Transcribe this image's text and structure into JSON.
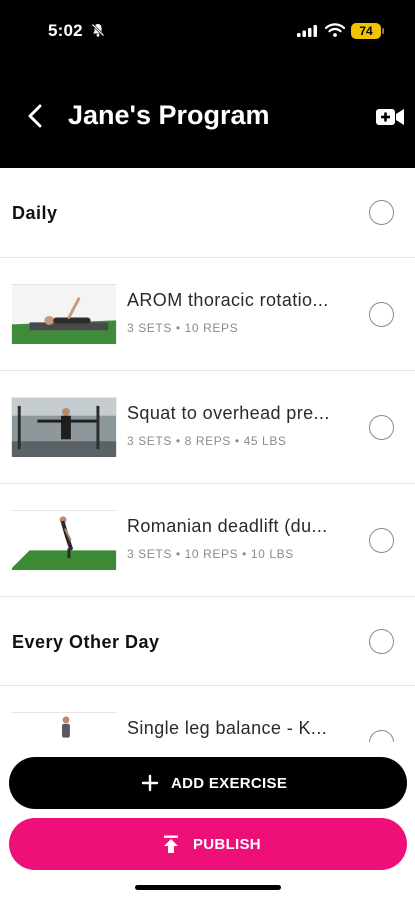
{
  "status_bar": {
    "time": "5:02",
    "battery": "74"
  },
  "header": {
    "title": "Jane's Program"
  },
  "sections": [
    {
      "label": "Daily",
      "exercises": [
        {
          "name": "AROM thoracic rotatio...",
          "meta": "3 SETS • 10 REPS"
        },
        {
          "name": "Squat to overhead pre...",
          "meta": "3 SETS • 8 REPS • 45 LBS"
        },
        {
          "name": "Romanian deadlift (du...",
          "meta": "3 SETS • 10 REPS • 10 LBS"
        }
      ]
    },
    {
      "label": "Every Other Day",
      "exercises": [
        {
          "name": "Single leg balance - K...",
          "meta": ""
        }
      ]
    }
  ],
  "actions": {
    "add_exercise": "ADD EXERCISE",
    "publish": "PUBLISH"
  },
  "colors": {
    "accent": "#ee0f78",
    "header_bg": "#000000",
    "battery": "#f2c300"
  },
  "icons": [
    "bell-off-icon",
    "signal-icon",
    "wifi-icon",
    "battery-icon",
    "back-chevron-icon",
    "video-camera-add-icon",
    "plus-icon",
    "upload-icon"
  ]
}
